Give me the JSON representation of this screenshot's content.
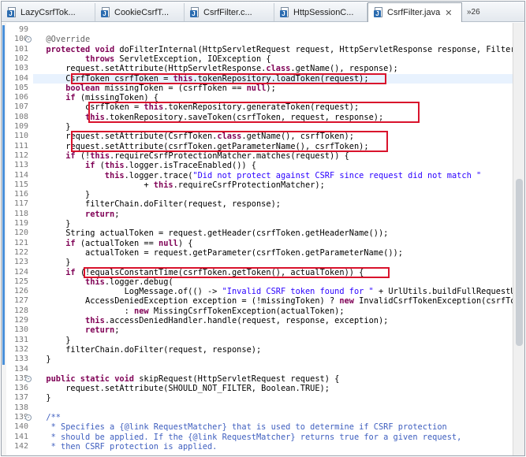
{
  "tabs": [
    {
      "label": "LazyCsrfTok...",
      "active": false
    },
    {
      "label": "CookieCsrfT...",
      "active": false
    },
    {
      "label": "CsrfFilter.c...",
      "active": false
    },
    {
      "label": "HttpSessionC...",
      "active": false
    },
    {
      "label": "CsrfFilter.java",
      "active": true
    }
  ],
  "tab_close_glyph": "✕",
  "overflow_label": "»26",
  "icons": {
    "java_file": "java-file-icon",
    "close": "close-icon",
    "fold": "fold-toggle-icon"
  },
  "colors": {
    "keyword": "#7f0055",
    "string": "#2a00ff",
    "comment": "#3f5fbf",
    "highlight_box": "#d9132c",
    "current_line": "#e8f2fe"
  },
  "current_line_number": "104",
  "highlighted_line_groups": [
    [
      "104"
    ],
    [
      "107",
      "108"
    ],
    [
      "110",
      "111"
    ],
    [
      "124"
    ]
  ],
  "lines": [
    {
      "n": "99",
      "segs": [
        [
          "",
          ""
        ]
      ]
    },
    {
      "n": "100",
      "fold": "-",
      "segs": [
        [
          "ann",
          "\t@Override"
        ]
      ]
    },
    {
      "n": "101",
      "segs": [
        [
          "kw",
          "\tprotected void "
        ],
        [
          "",
          "doFilterInternal(HttpServletRequest request, HttpServletResponse response, FilterChain fi"
        ]
      ]
    },
    {
      "n": "102",
      "segs": [
        [
          "",
          "\t\t\t"
        ],
        [
          "kw",
          "throws "
        ],
        [
          "",
          "ServletException, IOException {"
        ]
      ]
    },
    {
      "n": "103",
      "segs": [
        [
          "",
          "\t\trequest.setAttribute(HttpServletResponse."
        ],
        [
          "kw",
          "class"
        ],
        [
          "",
          ".getName(), response);"
        ]
      ]
    },
    {
      "n": "104",
      "segs": [
        [
          "",
          "\t\tCsrfToken csrfToken = "
        ],
        [
          "kw",
          "this"
        ],
        [
          "",
          ".tokenRepository.loadToken(request);"
        ]
      ]
    },
    {
      "n": "105",
      "segs": [
        [
          "",
          "\t\t"
        ],
        [
          "kw",
          "boolean "
        ],
        [
          "",
          "missingToken = (csrfToken == "
        ],
        [
          "kw",
          "null"
        ],
        [
          "",
          ");"
        ]
      ]
    },
    {
      "n": "106",
      "segs": [
        [
          "",
          "\t\t"
        ],
        [
          "kw",
          "if "
        ],
        [
          "",
          "(missingToken) {"
        ]
      ]
    },
    {
      "n": "107",
      "segs": [
        [
          "",
          "\t\t\tcsrfToken = "
        ],
        [
          "kw",
          "this"
        ],
        [
          "",
          ".tokenRepository.generateToken(request);"
        ]
      ]
    },
    {
      "n": "108",
      "segs": [
        [
          "",
          "\t\t\t"
        ],
        [
          "kw",
          "this"
        ],
        [
          "",
          ".tokenRepository.saveToken(csrfToken, request, response);"
        ]
      ]
    },
    {
      "n": "109",
      "segs": [
        [
          "",
          "\t\t}"
        ]
      ]
    },
    {
      "n": "110",
      "segs": [
        [
          "",
          "\t\trequest.setAttribute(CsrfToken."
        ],
        [
          "kw",
          "class"
        ],
        [
          "",
          ".getName(), csrfToken);"
        ]
      ]
    },
    {
      "n": "111",
      "segs": [
        [
          "",
          "\t\trequest.setAttribute(csrfToken.getParameterName(), csrfToken);"
        ]
      ]
    },
    {
      "n": "112",
      "segs": [
        [
          "",
          "\t\t"
        ],
        [
          "kw",
          "if "
        ],
        [
          "",
          "(!"
        ],
        [
          "kw",
          "this"
        ],
        [
          "",
          ".requireCsrfProtectionMatcher.matches(request)) {"
        ]
      ]
    },
    {
      "n": "113",
      "segs": [
        [
          "",
          "\t\t\t"
        ],
        [
          "kw",
          "if "
        ],
        [
          "",
          "("
        ],
        [
          "kw",
          "this"
        ],
        [
          "",
          ".logger.isTraceEnabled()) {"
        ]
      ]
    },
    {
      "n": "114",
      "segs": [
        [
          "",
          "\t\t\t\t"
        ],
        [
          "kw",
          "this"
        ],
        [
          "",
          ".logger.trace("
        ],
        [
          "str",
          "\"Did not protect against CSRF since request did not match \""
        ]
      ]
    },
    {
      "n": "115",
      "segs": [
        [
          "",
          "\t\t\t\t\t\t+ "
        ],
        [
          "kw",
          "this"
        ],
        [
          "",
          ".requireCsrfProtectionMatcher);"
        ]
      ]
    },
    {
      "n": "116",
      "segs": [
        [
          "",
          "\t\t\t}"
        ]
      ]
    },
    {
      "n": "117",
      "segs": [
        [
          "",
          "\t\t\tfilterChain.doFilter(request, response);"
        ]
      ]
    },
    {
      "n": "118",
      "segs": [
        [
          "",
          "\t\t\t"
        ],
        [
          "kw",
          "return"
        ],
        [
          "",
          ";"
        ]
      ]
    },
    {
      "n": "119",
      "segs": [
        [
          "",
          "\t\t}"
        ]
      ]
    },
    {
      "n": "120",
      "segs": [
        [
          "",
          "\t\tString actualToken = request.getHeader(csrfToken.getHeaderName());"
        ]
      ]
    },
    {
      "n": "121",
      "segs": [
        [
          "",
          "\t\t"
        ],
        [
          "kw",
          "if "
        ],
        [
          "",
          "(actualToken == "
        ],
        [
          "kw",
          "null"
        ],
        [
          "",
          ") {"
        ]
      ]
    },
    {
      "n": "122",
      "segs": [
        [
          "",
          "\t\t\tactualToken = request.getParameter(csrfToken.getParameterName());"
        ]
      ]
    },
    {
      "n": "123",
      "segs": [
        [
          "",
          "\t\t}"
        ]
      ]
    },
    {
      "n": "124",
      "segs": [
        [
          "",
          "\t\t"
        ],
        [
          "kw",
          "if "
        ],
        [
          "",
          "(!equalsConstantTime(csrfToken.getToken(), actualToken)) {"
        ]
      ]
    },
    {
      "n": "125",
      "segs": [
        [
          "",
          "\t\t\t"
        ],
        [
          "kw",
          "this"
        ],
        [
          "",
          ".logger.debug("
        ]
      ]
    },
    {
      "n": "126",
      "segs": [
        [
          "",
          "\t\t\t\t\tLogMessage.of(() -> "
        ],
        [
          "str",
          "\"Invalid CSRF token found for \""
        ],
        [
          "",
          " + UrlUtils.buildFullRequestUrl(request"
        ]
      ]
    },
    {
      "n": "127",
      "segs": [
        [
          "",
          "\t\t\tAccessDeniedException exception = (!missingToken) ? "
        ],
        [
          "kw",
          "new "
        ],
        [
          "",
          "InvalidCsrfTokenException(csrfToken, act"
        ]
      ]
    },
    {
      "n": "128",
      "segs": [
        [
          "",
          "\t\t\t\t\t: "
        ],
        [
          "kw",
          "new "
        ],
        [
          "",
          "MissingCsrfTokenException(actualToken);"
        ]
      ]
    },
    {
      "n": "129",
      "segs": [
        [
          "",
          "\t\t\t"
        ],
        [
          "kw",
          "this"
        ],
        [
          "",
          ".accessDeniedHandler.handle(request, response, exception);"
        ]
      ]
    },
    {
      "n": "130",
      "segs": [
        [
          "",
          "\t\t\t"
        ],
        [
          "kw",
          "return"
        ],
        [
          "",
          ";"
        ]
      ]
    },
    {
      "n": "131",
      "segs": [
        [
          "",
          "\t\t}"
        ]
      ]
    },
    {
      "n": "132",
      "segs": [
        [
          "",
          "\t\tfilterChain.doFilter(request, response);"
        ]
      ]
    },
    {
      "n": "133",
      "segs": [
        [
          "",
          "\t}"
        ]
      ]
    },
    {
      "n": "134",
      "segs": [
        [
          "",
          ""
        ]
      ]
    },
    {
      "n": "135",
      "fold": "-",
      "segs": [
        [
          "kw",
          "\tpublic static void "
        ],
        [
          "",
          "skipRequest(HttpServletRequest request) {"
        ]
      ]
    },
    {
      "n": "136",
      "segs": [
        [
          "",
          "\t\trequest.setAttribute(SHOULD_NOT_FILTER, Boolean.TRUE);"
        ]
      ]
    },
    {
      "n": "137",
      "segs": [
        [
          "",
          "\t}"
        ]
      ]
    },
    {
      "n": "138",
      "segs": [
        [
          "",
          ""
        ]
      ]
    },
    {
      "n": "139",
      "fold": "-",
      "segs": [
        [
          "cm",
          "\t/**"
        ]
      ]
    },
    {
      "n": "140",
      "segs": [
        [
          "cm",
          "\t * Specifies a {@link RequestMatcher} that is used to determine if CSRF protection"
        ]
      ]
    },
    {
      "n": "141",
      "segs": [
        [
          "cm",
          "\t * should be applied. If the {@link RequestMatcher} returns true for a given request,"
        ]
      ]
    },
    {
      "n": "142",
      "segs": [
        [
          "cm",
          "\t * then CSRF protection is applied."
        ]
      ]
    }
  ]
}
